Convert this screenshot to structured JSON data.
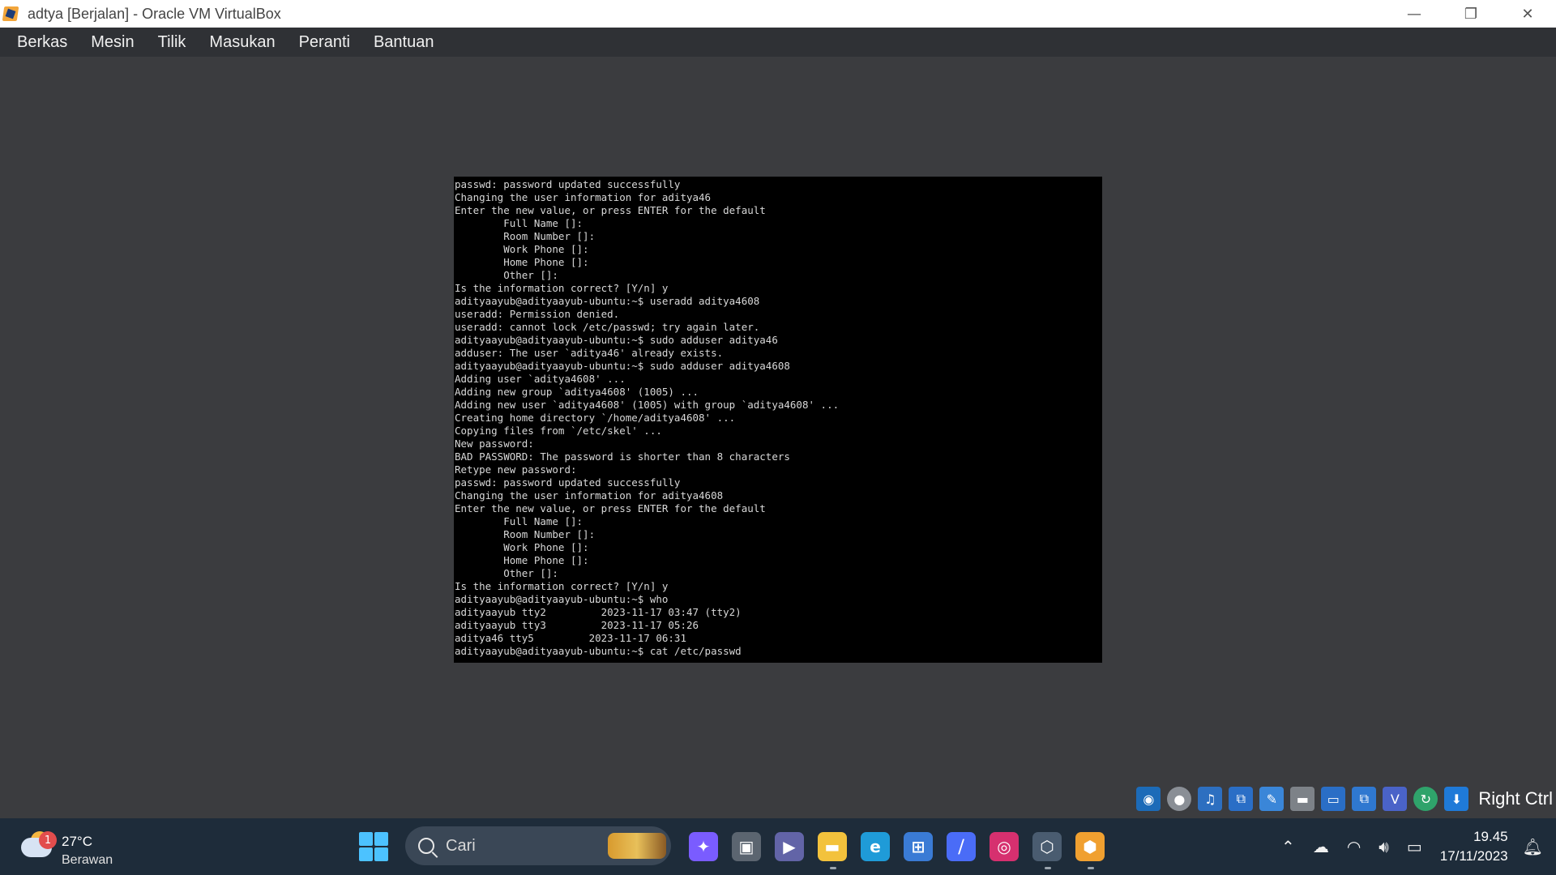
{
  "window": {
    "title": "adtya [Berjalan] - Oracle VM VirtualBox",
    "controls": [
      "—",
      "❐",
      "✕"
    ]
  },
  "menu": [
    "Berkas",
    "Mesin",
    "Tilik",
    "Masukan",
    "Peranti",
    "Bantuan"
  ],
  "terminal": {
    "lines": [
      "passwd: password updated successfully",
      "Changing the user information for aditya46",
      "Enter the new value, or press ENTER for the default",
      "        Full Name []:",
      "        Room Number []:",
      "        Work Phone []:",
      "        Home Phone []:",
      "        Other []:",
      "Is the information correct? [Y/n] y",
      "adityaayub@adityaayub-ubuntu:~$ useradd aditya4608",
      "useradd: Permission denied.",
      "useradd: cannot lock /etc/passwd; try again later.",
      "adityaayub@adityaayub-ubuntu:~$ sudo adduser aditya46",
      "adduser: The user `aditya46' already exists.",
      "adityaayub@adityaayub-ubuntu:~$ sudo adduser aditya4608",
      "Adding user `aditya4608' ...",
      "Adding new group `aditya4608' (1005) ...",
      "Adding new user `aditya4608' (1005) with group `aditya4608' ...",
      "Creating home directory `/home/aditya4608' ...",
      "Copying files from `/etc/skel' ...",
      "New password:",
      "BAD PASSWORD: The password is shorter than 8 characters",
      "Retype new password:",
      "passwd: password updated successfully",
      "Changing the user information for aditya4608",
      "Enter the new value, or press ENTER for the default",
      "        Full Name []:",
      "        Room Number []:",
      "        Work Phone []:",
      "        Home Phone []:",
      "        Other []:",
      "Is the information correct? [Y/n] y",
      "adityaayub@adityaayub-ubuntu:~$ who",
      "adityaayub tty2         2023-11-17 03:47 (tty2)",
      "adityaayub tty3         2023-11-17 05:26",
      "aditya46 tty5         2023-11-17 06:31",
      "adityaayub@adityaayub-ubuntu:~$ cat /etc/passwd"
    ]
  },
  "statusbar": {
    "host_key": "Right Ctrl",
    "icons": [
      "hard-disk-icon",
      "optical-drive-icon",
      "audio-icon",
      "network-icon",
      "usb-icon",
      "shared-folders-icon",
      "display-icon",
      "recording-icon",
      "vrde-icon",
      "cpu-icon",
      "mouse-integration-icon"
    ]
  },
  "taskbar": {
    "weather": {
      "temp": "27°C",
      "condition": "Berawan",
      "badge": "1"
    },
    "search_placeholder": "Cari",
    "apps": [
      {
        "name": "copilot",
        "glyph": "✦",
        "color": "#7a5cff"
      },
      {
        "name": "task-view",
        "glyph": "▣",
        "color": "#5b6570"
      },
      {
        "name": "teams-chat",
        "glyph": "▶",
        "color": "#6264a7"
      },
      {
        "name": "file-explorer",
        "glyph": "▬",
        "color": "#f3c23c"
      },
      {
        "name": "edge",
        "glyph": "e",
        "color": "#1f9bd8"
      },
      {
        "name": "microsoft-store",
        "glyph": "⊞",
        "color": "#3a7bd5"
      },
      {
        "name": "vscode-like",
        "glyph": "⧸",
        "color": "#4a6cf7"
      },
      {
        "name": "instagram",
        "glyph": "◎",
        "color": "#d6306f"
      },
      {
        "name": "virtualbox",
        "glyph": "⬡",
        "color": "#4a5c70"
      },
      {
        "name": "virtualbox-vm",
        "glyph": "⬢",
        "color": "#f0a030"
      }
    ],
    "clock": {
      "time": "19.45",
      "date": "17/11/2023"
    }
  }
}
